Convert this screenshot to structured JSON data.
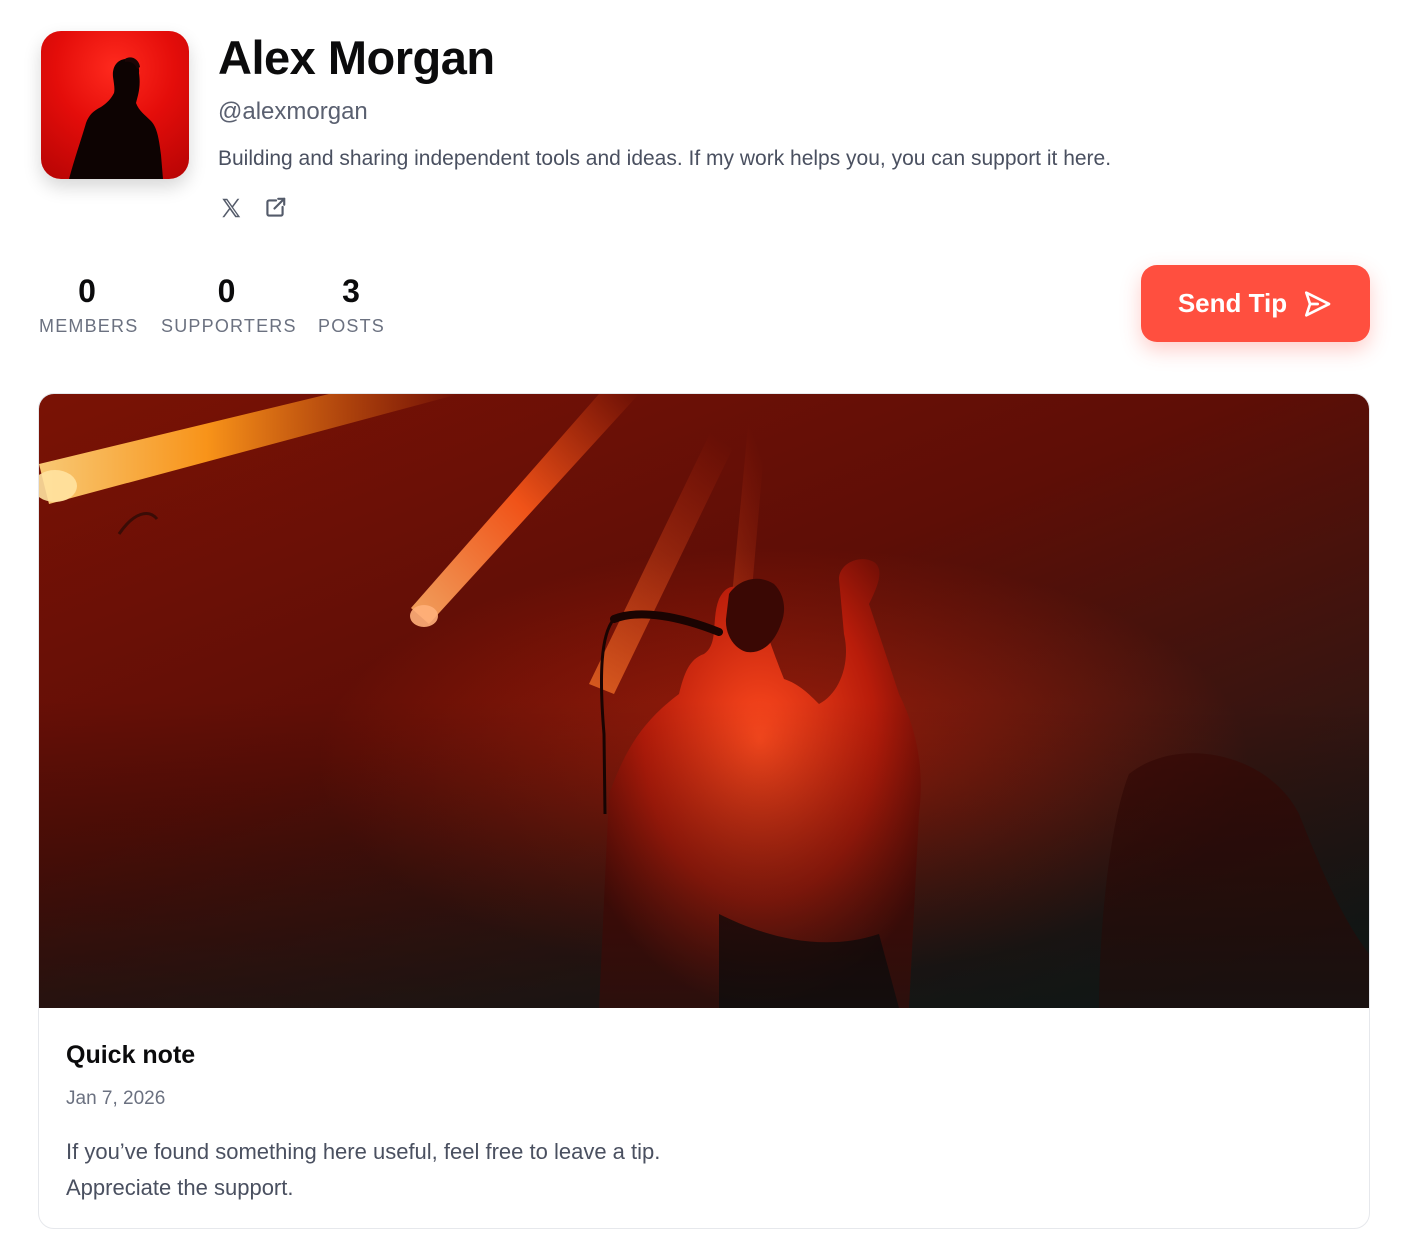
{
  "profile": {
    "name": "Alex Morgan",
    "handle": "@alexmorgan",
    "bio": "Building and sharing independent tools and ideas. If my work helps you, you can support it here.",
    "social_links": [
      {
        "icon": "x-twitter-icon"
      },
      {
        "icon": "external-link-icon"
      }
    ]
  },
  "stats": [
    {
      "value": "0",
      "label": "MEMBERS"
    },
    {
      "value": "0",
      "label": "SUPPORTERS"
    },
    {
      "value": "3",
      "label": "POSTS"
    }
  ],
  "actions": {
    "tip_label": "Send Tip",
    "tip_icon": "send-icon"
  },
  "post": {
    "title": "Quick note",
    "date": "Jan 7, 2026",
    "body_lines": [
      "If you’ve found something here useful, feel free to leave a tip.",
      "Appreciate the support."
    ]
  },
  "colors": {
    "accent": "#ff4f3f",
    "avatar_bg": "#e40d0a",
    "text_primary": "#0b0b0c",
    "text_secondary": "#5a6070"
  }
}
